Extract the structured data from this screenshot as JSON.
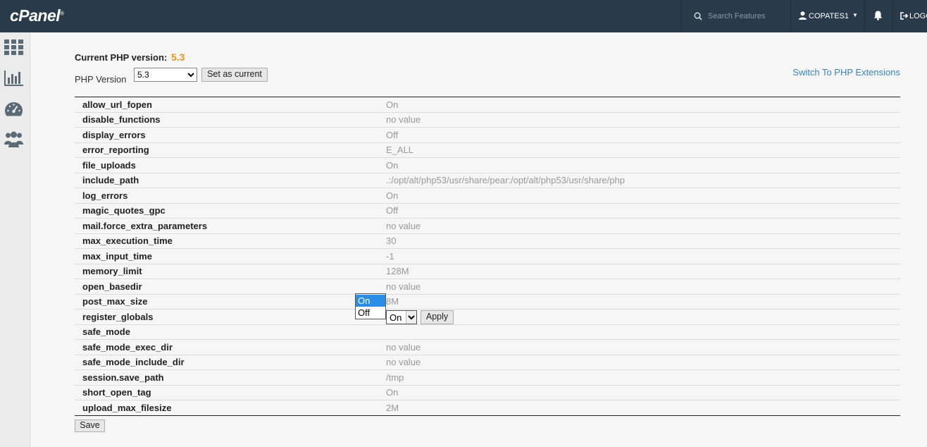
{
  "header": {
    "logo": "cPanel",
    "search_placeholder": "Search Features",
    "username": "COPATES1",
    "logout": "LOGOUT"
  },
  "sidebar": {
    "icons": [
      "grid-icon",
      "stats-icon",
      "dashboard-icon",
      "users-icon"
    ]
  },
  "php": {
    "current_label": "Current PHP version:",
    "current_version": "5.3",
    "version_label": "PHP Version",
    "selected_version": "5.3",
    "set_current_label": "Set as current",
    "switch_link": "Switch To PHP Extensions"
  },
  "settings": [
    {
      "key": "allow_url_fopen",
      "value": "On"
    },
    {
      "key": "disable_functions",
      "value": "no value"
    },
    {
      "key": "display_errors",
      "value": "Off"
    },
    {
      "key": "error_reporting",
      "value": "E_ALL"
    },
    {
      "key": "file_uploads",
      "value": "On"
    },
    {
      "key": "include_path",
      "value": ".:/opt/alt/php53/usr/share/pear:/opt/alt/php53/usr/share/php"
    },
    {
      "key": "log_errors",
      "value": "On"
    },
    {
      "key": "magic_quotes_gpc",
      "value": "Off"
    },
    {
      "key": "mail.force_extra_parameters",
      "value": "no value"
    },
    {
      "key": "max_execution_time",
      "value": "30"
    },
    {
      "key": "max_input_time",
      "value": "-1"
    },
    {
      "key": "memory_limit",
      "value": "128M"
    },
    {
      "key": "open_basedir",
      "value": "no value"
    },
    {
      "key": "post_max_size",
      "value": "8M"
    },
    {
      "key": "register_globals",
      "value": "On"
    },
    {
      "key": "safe_mode",
      "value": ""
    },
    {
      "key": "safe_mode_exec_dir",
      "value": "no value"
    },
    {
      "key": "safe_mode_include_dir",
      "value": "no value"
    },
    {
      "key": "session.save_path",
      "value": "/tmp"
    },
    {
      "key": "short_open_tag",
      "value": "On"
    },
    {
      "key": "upload_max_filesize",
      "value": "2M"
    }
  ],
  "register_globals_edit": {
    "selected": "On",
    "apply_label": "Apply",
    "options": [
      "On",
      "Off"
    ]
  },
  "save_label": "Save",
  "colors": {
    "topbar": "#293a4a",
    "accent_version": "#e8901e",
    "link": "#3b84c0",
    "dropdown_highlight": "#2a8ee6"
  }
}
